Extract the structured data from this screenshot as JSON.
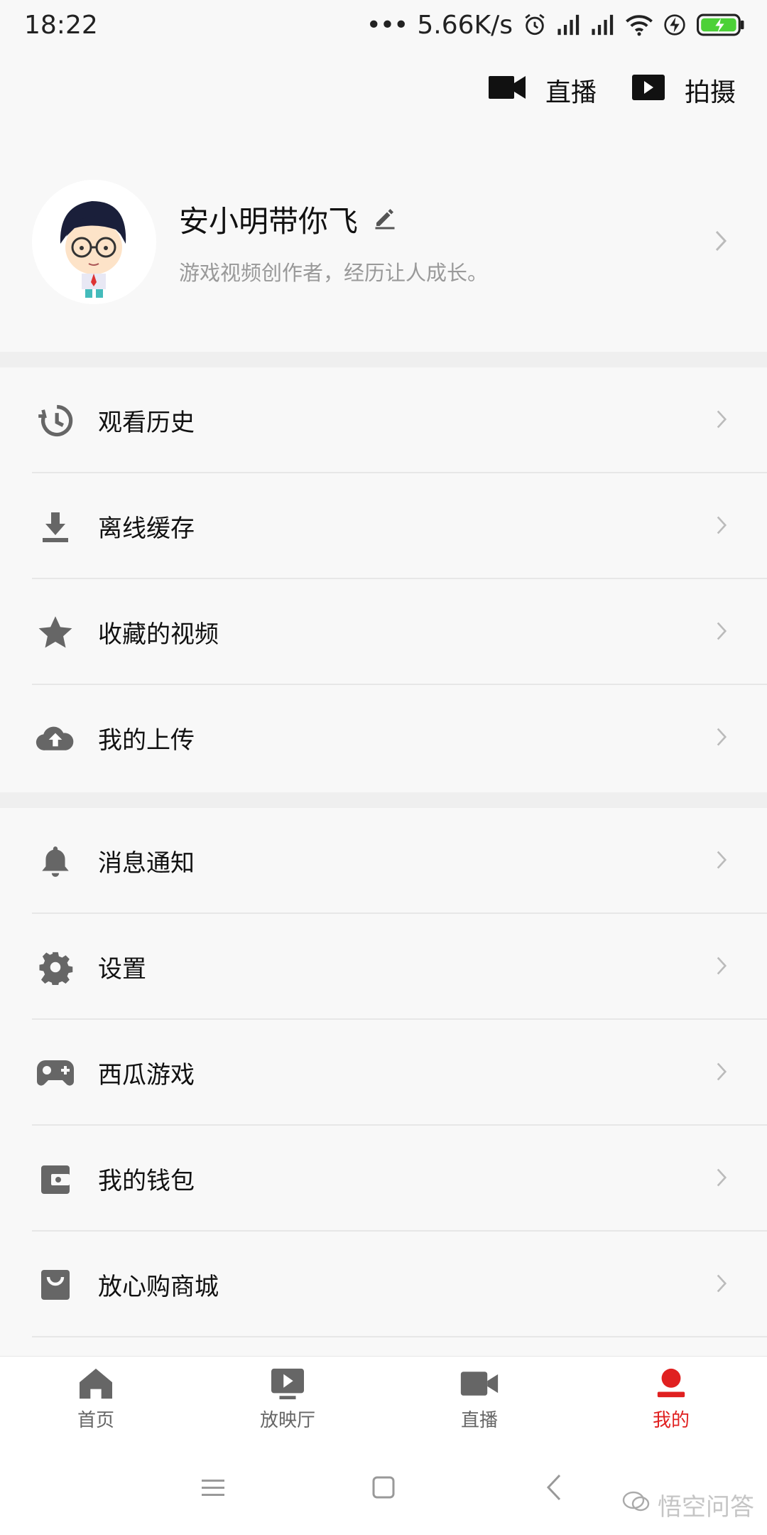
{
  "status": {
    "time": "18:22",
    "network_speed": "5.66K/s"
  },
  "top_actions": {
    "live_label": "直播",
    "shoot_label": "拍摄"
  },
  "profile": {
    "name": "安小明带你飞",
    "bio": "游戏视频创作者，经历让人成长。"
  },
  "menu_group1": [
    {
      "label": "观看历史",
      "icon": "history-icon"
    },
    {
      "label": "离线缓存",
      "icon": "download-icon"
    },
    {
      "label": "收藏的视频",
      "icon": "star-icon"
    },
    {
      "label": "我的上传",
      "icon": "cloud-upload-icon"
    }
  ],
  "menu_group2": [
    {
      "label": "消息通知",
      "icon": "bell-icon"
    },
    {
      "label": "设置",
      "icon": "gear-icon"
    },
    {
      "label": "西瓜游戏",
      "icon": "gamepad-icon"
    },
    {
      "label": "我的钱包",
      "icon": "wallet-icon"
    },
    {
      "label": "放心购商城",
      "icon": "shopping-bag-icon"
    }
  ],
  "tabs": [
    {
      "label": "首页",
      "icon": "home-icon"
    },
    {
      "label": "放映厅",
      "icon": "theater-icon"
    },
    {
      "label": "直播",
      "icon": "live-camera-icon"
    },
    {
      "label": "我的",
      "icon": "person-icon",
      "active": true
    }
  ],
  "colors": {
    "accent": "#e02020",
    "icon_gray": "#666666",
    "background": "#f8f8f8",
    "battery_green": "#4cd137"
  },
  "watermark": "悟空问答"
}
